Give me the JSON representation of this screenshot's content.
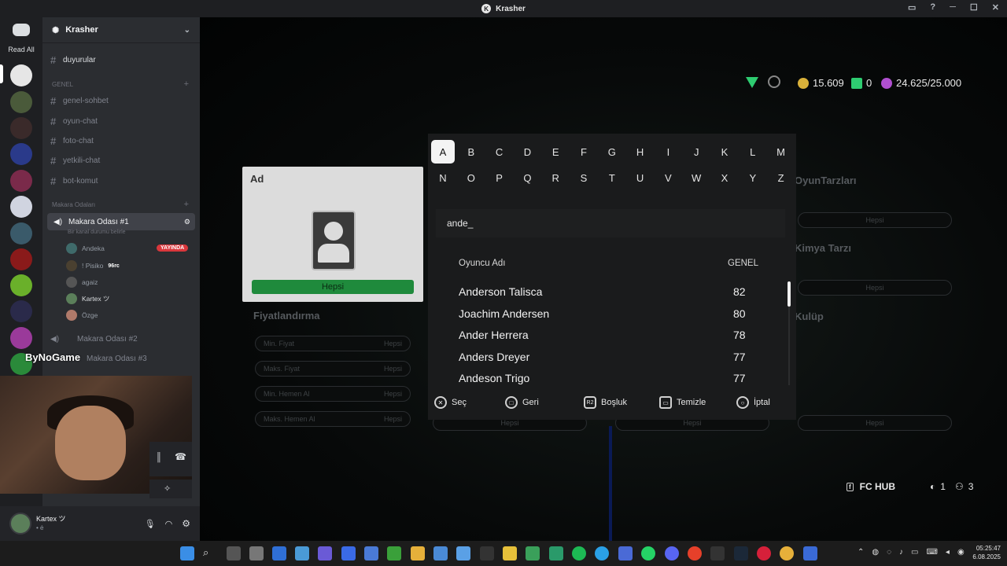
{
  "window": {
    "title": "Krasher"
  },
  "rail": {
    "read_all": "Read All"
  },
  "server": {
    "name": "Krasher"
  },
  "channels": {
    "duyurular": "duyurular",
    "category_genel": "GENEL",
    "genel_sohbet": "genel-sohbet",
    "oyun_chat": "oyun-chat",
    "foto_chat": "foto-chat",
    "yetkili_chat": "yetkili-chat",
    "bot_komut": "bot-komut",
    "category_makara": "Makara Odaları",
    "voice1": "Makara Odası #1",
    "voice1_status": "Bir kanal durumu belirle",
    "voice2": "Makara Odası #2",
    "voice3": "Makara Odası #3",
    "overlay_text": "ByNoGame"
  },
  "voice_members": [
    {
      "name": "Andeka",
      "badge": "YAYINDA"
    },
    {
      "name": "! Pisiko",
      "tag": "96rc"
    },
    {
      "name": "agaiz"
    },
    {
      "name": "Kartex ツ"
    },
    {
      "name": "Özge"
    }
  ],
  "user": {
    "name": "Kartex ツ",
    "status": "• ė"
  },
  "game": {
    "currency": [
      {
        "value": "15.609",
        "color": "#d9b13a"
      },
      {
        "value": "0",
        "color": "#2ecc71"
      },
      {
        "value": "24.625/25.000",
        "color": "#b04fd0"
      }
    ],
    "panel": {
      "label": "Ad",
      "button": "Hepsi"
    },
    "bg_titles": {
      "oyun_tarzlari": "OyunTarzları",
      "kimya_tarzi": "Kimya Tarzı",
      "kulup": "Kulüp",
      "fiyatlandirma": "Fiyatlandırma"
    },
    "bg_pills": {
      "min_fiyat": "Min. Fiyat",
      "maks_fiyat": "Maks. Fiyat",
      "min_hemen": "Min. Hemen Al",
      "maks_hemen": "Maks. Hemen Al",
      "hepsi": "Hepsi"
    },
    "keyboard": {
      "row1": [
        "A",
        "B",
        "C",
        "D",
        "E",
        "F",
        "G",
        "H",
        "I",
        "J",
        "K",
        "L",
        "M"
      ],
      "row2": [
        "N",
        "O",
        "P",
        "Q",
        "R",
        "S",
        "T",
        "U",
        "V",
        "W",
        "X",
        "Y",
        "Z"
      ],
      "selected": "A",
      "input": "ande_",
      "col_name": "Oyuncu Adı",
      "col_rating": "GENEL",
      "results": [
        {
          "name": "Anderson Talisca",
          "rating": "82"
        },
        {
          "name": "Joachim Andersen",
          "rating": "80"
        },
        {
          "name": "Ander Herrera",
          "rating": "78"
        },
        {
          "name": "Anders Dreyer",
          "rating": "77"
        },
        {
          "name": "Andeson Trigo",
          "rating": "77"
        }
      ],
      "hints": {
        "select": "Seç",
        "back": "Geri",
        "space": "Boşluk",
        "clear": "Temizle",
        "cancel": "İptal",
        "r2": "R2"
      }
    },
    "hub": {
      "label": "FC HUB",
      "count1": "1",
      "count2": "3"
    }
  },
  "taskbar": {
    "time": "05:25:47",
    "date": "6.08.2025"
  }
}
